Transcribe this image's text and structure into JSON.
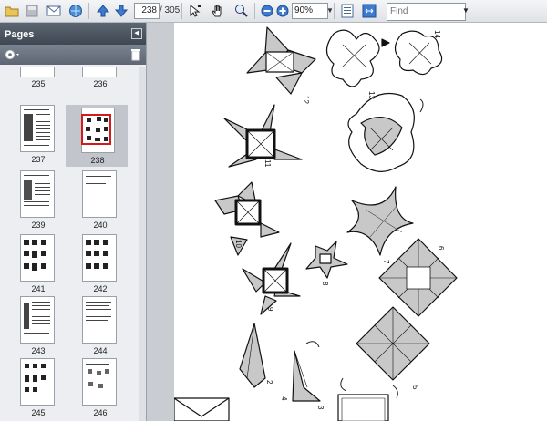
{
  "toolbar": {
    "current_page": "238",
    "page_total": "/ 305",
    "zoom": "90%",
    "find_placeholder": "Find"
  },
  "pages_panel": {
    "title": "Pages",
    "thumbnails": [
      {
        "label": "235"
      },
      {
        "label": "236"
      },
      {
        "label": "237"
      },
      {
        "label": "238",
        "selected": true
      },
      {
        "label": "239"
      },
      {
        "label": "240"
      },
      {
        "label": "241"
      },
      {
        "label": "242"
      },
      {
        "label": "243"
      },
      {
        "label": "244"
      },
      {
        "label": "245"
      },
      {
        "label": "246"
      }
    ]
  },
  "document": {
    "step_numbers": [
      "12",
      "13",
      "14",
      "11",
      "10",
      "9",
      "8",
      "7",
      "6",
      "5",
      "4",
      "3",
      "2"
    ]
  },
  "colors": {
    "panel_header": "#4a535e",
    "selection_border": "#d31b1b",
    "diagram_fill": "#c8c8c8"
  }
}
